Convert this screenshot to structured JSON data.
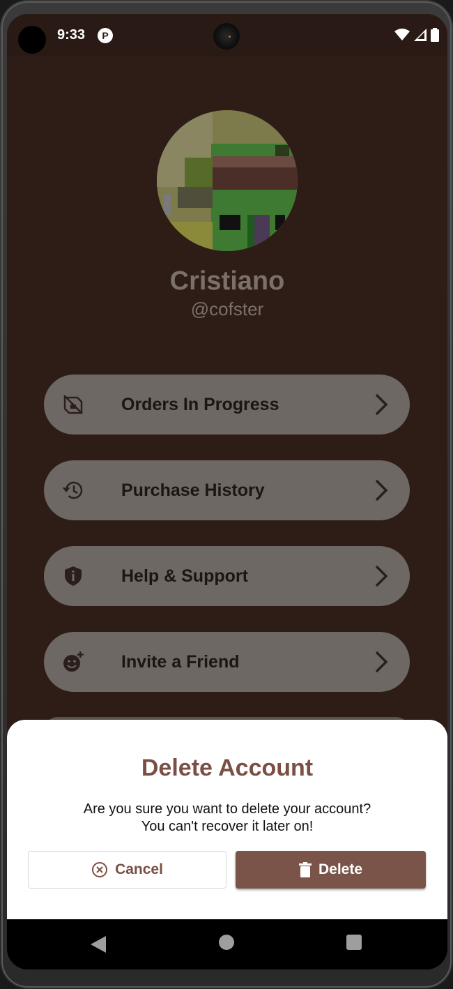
{
  "status_bar": {
    "time": "9:33",
    "app_icon_glyph": "P",
    "icons": [
      "wifi-icon",
      "signal-icon",
      "battery-icon"
    ]
  },
  "profile": {
    "name": "Cristiano",
    "handle": "@cofster"
  },
  "menu": {
    "items": [
      {
        "label": "Orders In Progress",
        "icon": "orders-icon"
      },
      {
        "label": "Purchase History",
        "icon": "history-icon"
      },
      {
        "label": "Help & Support",
        "icon": "shield-icon"
      },
      {
        "label": "Invite a Friend",
        "icon": "add-friend-icon"
      }
    ]
  },
  "dialog": {
    "title": "Delete Account",
    "message_line1": "Are you sure you want to delete your account?",
    "message_line2": "You can't recover it later on!",
    "cancel_label": "Cancel",
    "delete_label": "Delete"
  },
  "colors": {
    "screen_bg": "#2e1d17",
    "menu_bg": "#6e6865",
    "accent": "#7b4f44",
    "delete_button": "#7b5449"
  }
}
